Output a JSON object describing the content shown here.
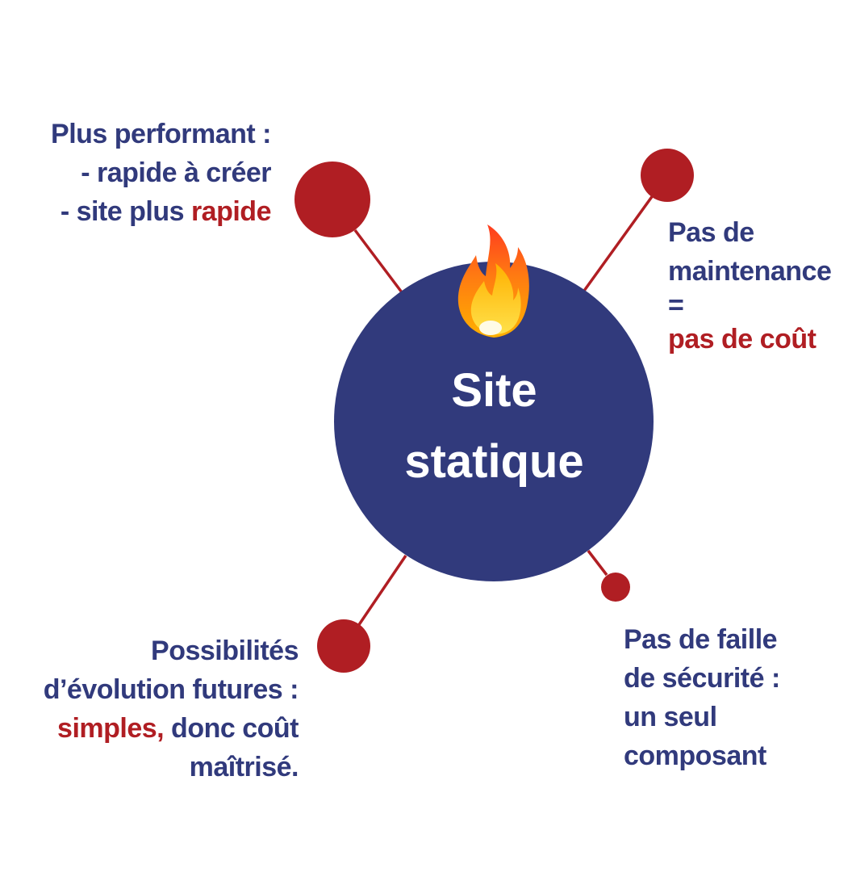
{
  "colors": {
    "navy": "#313a7c",
    "red": "#b01e23",
    "white": "#ffffff"
  },
  "center": {
    "icon": "flame-icon",
    "title_line1": "Site",
    "title_line2": "statique"
  },
  "nodes": {
    "top_left": {
      "line1": "Plus performant :",
      "line2": "- rapide à créer",
      "line3_prefix": "- site plus ",
      "line3_accent": "rapide"
    },
    "top_right": {
      "line1": "Pas de",
      "line2": "maintenance",
      "line3": "=",
      "line4_accent": "pas de coût"
    },
    "bottom_left": {
      "line1": "Possibilités",
      "line2": "d’évolution futures :",
      "line3_accent": "simples,",
      "line3_suffix": " donc coût",
      "line4": "maîtrisé."
    },
    "bottom_right": {
      "line1": "Pas de faille",
      "line2": "de sécurité :",
      "line3": "un seul",
      "line4": "composant"
    }
  }
}
